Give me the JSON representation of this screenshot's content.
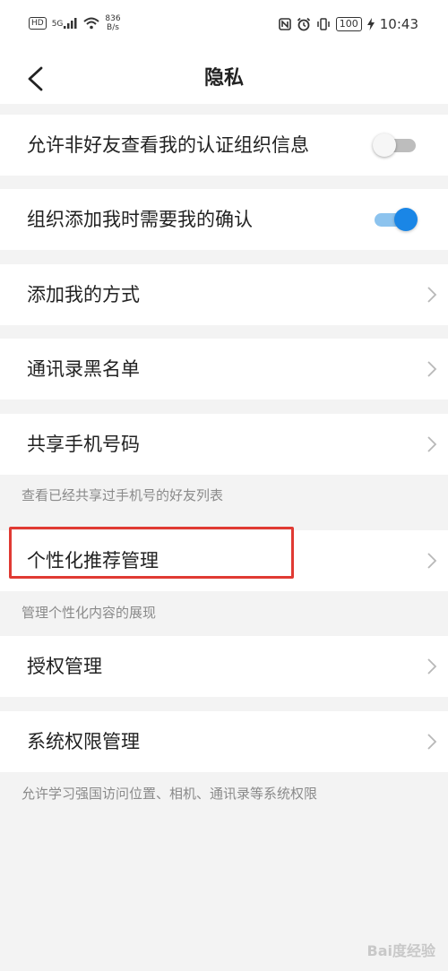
{
  "status_bar": {
    "hd": "HD",
    "signal": "5G",
    "speed_value": "836",
    "speed_unit": "B/s",
    "battery": "100",
    "time": "10:43",
    "icons": [
      "nfc-icon",
      "alarm-icon",
      "vibrate-icon",
      "battery-icon",
      "charging-icon"
    ]
  },
  "header": {
    "title": "隐私"
  },
  "rows": [
    {
      "label": "允许非好友查看我的认证组织信息",
      "control": "toggle",
      "on": false
    },
    {
      "label": "组织添加我时需要我的确认",
      "control": "toggle",
      "on": true
    },
    {
      "label": "添加我的方式",
      "control": "chevron"
    },
    {
      "label": "通讯录黑名单",
      "control": "chevron"
    },
    {
      "label": "共享手机号码",
      "control": "chevron"
    },
    {
      "label": "个性化推荐管理",
      "control": "chevron"
    },
    {
      "label": "授权管理",
      "control": "chevron"
    },
    {
      "label": "系统权限管理",
      "control": "chevron"
    }
  ],
  "hints": {
    "share_phone": "查看已经共享过手机号的好友列表",
    "personalized": "管理个性化内容的展现",
    "system_permission": "允许学习强国访问位置、相机、通讯录等系统权限"
  },
  "watermark": "Bai度经验",
  "colors": {
    "accent": "#1a86e6",
    "highlight_box": "#e03a33",
    "background": "#f3f3f3"
  }
}
